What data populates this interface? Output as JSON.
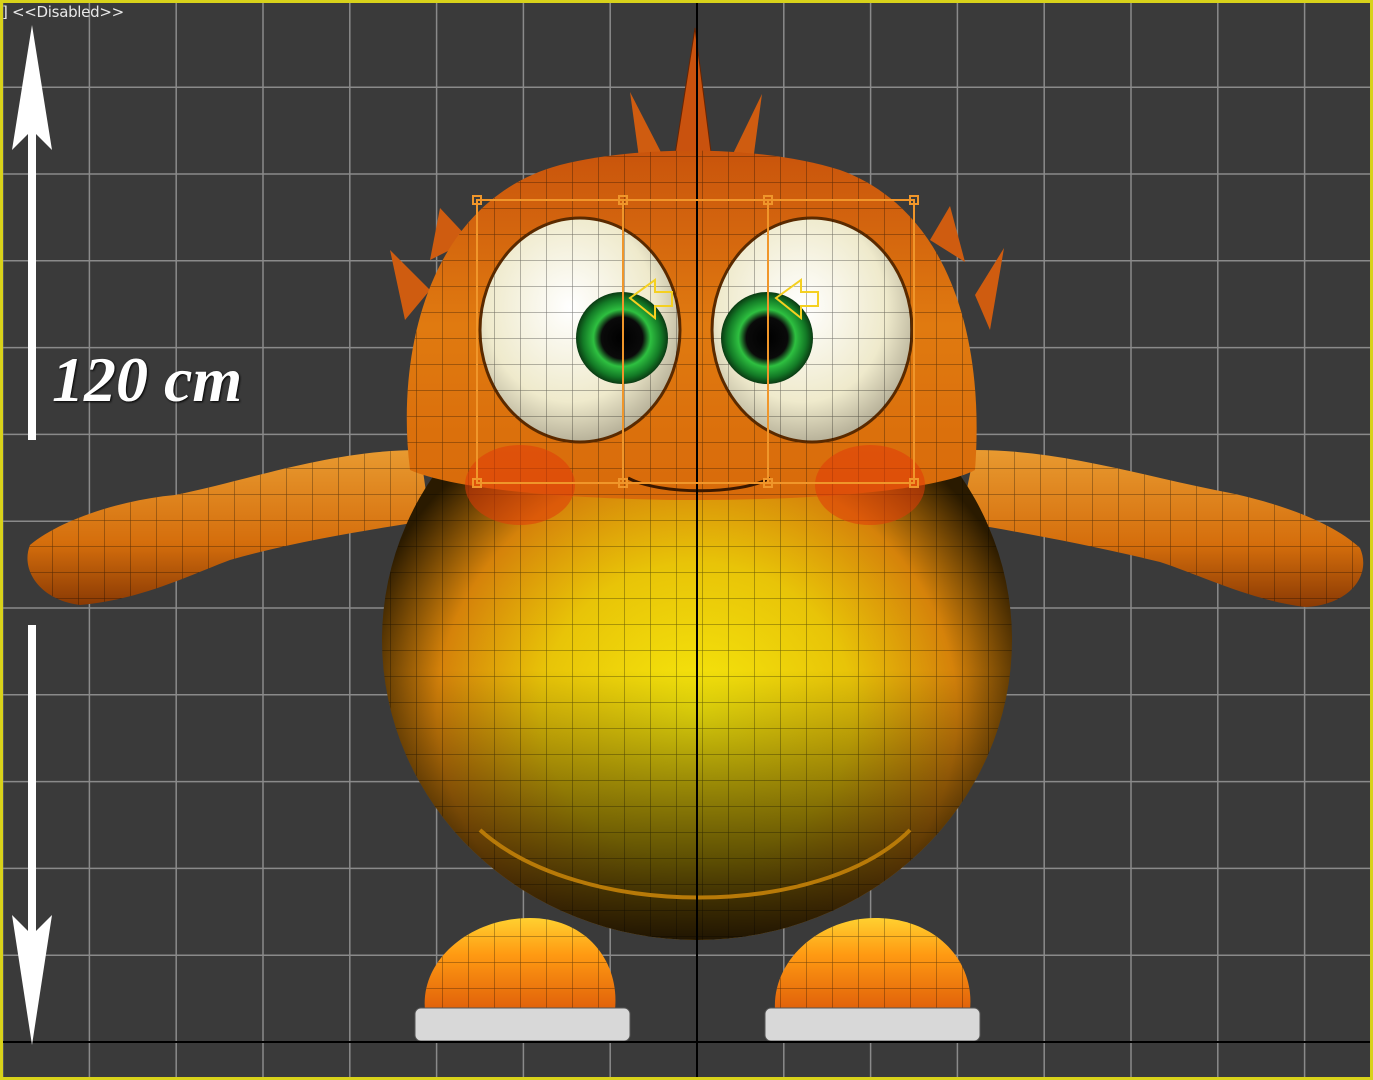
{
  "viewport": {
    "label": "] <<Disabled>>",
    "border_color": "#d8d21a",
    "background_color": "#3a3a3a",
    "grid_color": "#8a8a8a",
    "axis_color": "#000000"
  },
  "annotation": {
    "dimension_text": "120 cm",
    "arrow_up_icon": "arrow-up-icon",
    "arrow_down_icon": "arrow-down-icon"
  },
  "model": {
    "body_colors": {
      "orange": "#e07a10",
      "yellow": "#f2e20a",
      "dark": "#1a1200",
      "eye_white": "#f4f1dc",
      "iris": "#1f9a3a",
      "shoe": "#ff8c10",
      "sole": "#d8d8d8"
    },
    "selection_color": "#f0962a"
  }
}
